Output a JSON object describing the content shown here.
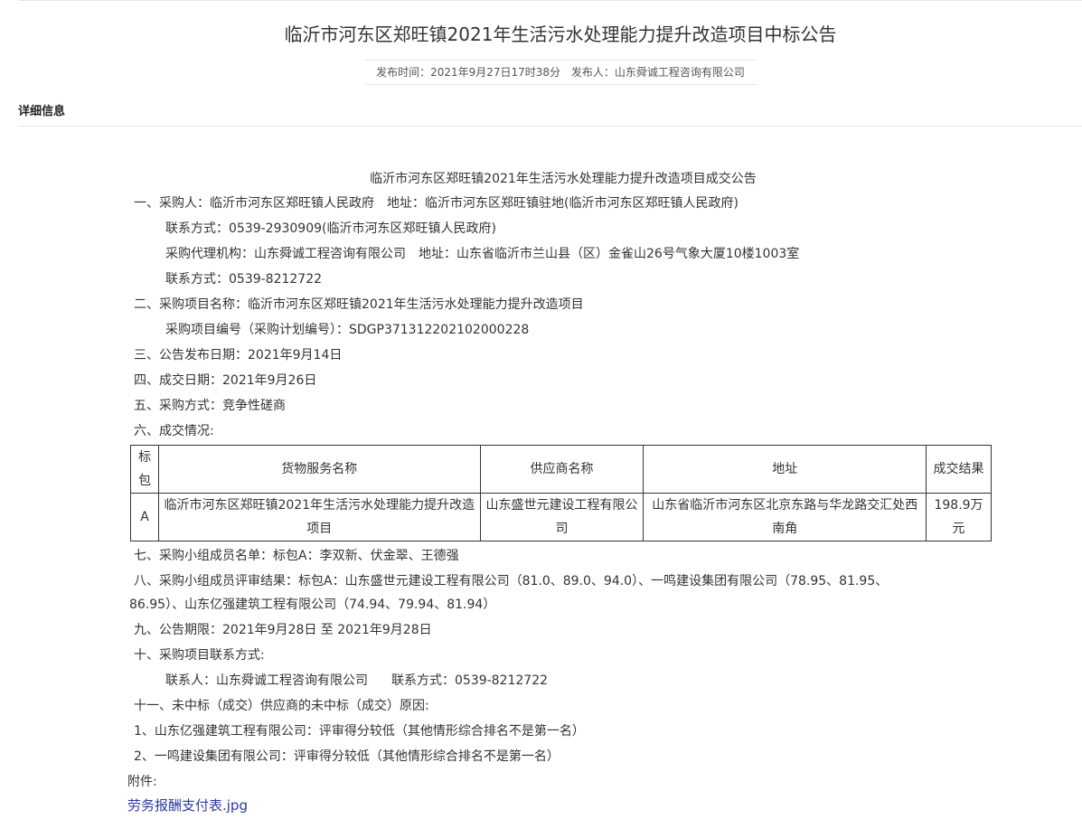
{
  "page_title": "临沂市河东区郑旺镇2021年生活污水处理能力提升改造项目中标公告",
  "meta": {
    "publish_time": "发布时间：2021年9月27日17时38分",
    "publisher": "发布人：山东舜诚工程咨询有限公司"
  },
  "detail_label": "详细信息",
  "doc": {
    "title": "临沂市河东区郑旺镇2021年生活污水处理能力提升改造项目成交公告",
    "purchaser": "一、采购人：临沂市河东区郑旺镇人民政府",
    "purchaser_address": "地址：临沂市河东区郑旺镇驻地(临沂市河东区郑旺镇人民政府)",
    "purchaser_contact": "联系方式：0539-2930909(临沂市河东区郑旺镇人民政府)",
    "agency": "采购代理机构：山东舜诚工程咨询有限公司",
    "agency_address": "地址：山东省临沂市兰山县（区）金雀山26号气象大厦10楼1003室",
    "agency_contact": "联系方式：0539-8212722",
    "project_name": "二、采购项目名称：临沂市河东区郑旺镇2021年生活污水处理能力提升改造项目",
    "project_code": "采购项目编号（采购计划编号）：SDGP371312202102000228",
    "announce_date": "三、公告发布日期：2021年9月14日",
    "deal_date": "四、成交日期：2021年9月26日",
    "method": "五、采购方式：竞争性磋商",
    "deal_info": "六、成交情况:",
    "table": {
      "headers": [
        "标包",
        "货物服务名称",
        "供应商名称",
        "地址",
        "成交结果"
      ],
      "rows": [
        [
          "A",
          "临沂市河东区郑旺镇2021年生活污水处理能力提升改造项目",
          "山东盛世元建设工程有限公司",
          "山东省临沂市河东区北京东路与华龙路交汇处西南角",
          "198.9万元"
        ]
      ]
    },
    "panel_members": "七、采购小组成员名单：标包A：李双新、伏金翠、王德强",
    "review_line1": "八、采购小组成员评审结果：标包A：山东盛世元建设工程有限公司（81.0、89.0、94.0）、一鸣建设集团有限公司（78.95、81.95、",
    "review_line2": "86.95）、山东亿强建筑工程有限公司（74.94、79.94、81.94）",
    "period": "九、公告期限：2021年9月28日 至 2021年9月28日",
    "contact_title": "十、采购项目联系方式:",
    "contact_person": "联系人：山东舜诚工程咨询有限公司",
    "contact_phone": "联系方式：0539-8212722",
    "unsuccessful_title": "十一、未中标（成交）供应商的未中标（成交）原因:",
    "unsuccessful_1": "1、山东亿强建筑工程有限公司：评审得分较低（其他情形综合排名不是第一名）",
    "unsuccessful_2": "2、一鸣建设集团有限公司：评审得分较低（其他情形综合排名不是第一名）",
    "attachment_label": "附件:",
    "attachment_file": "劳务报酬支付表.jpg"
  }
}
